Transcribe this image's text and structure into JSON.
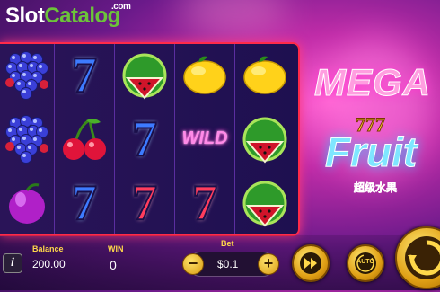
{
  "watermark": {
    "slot": "Slot",
    "catalog": "Catalog",
    "com": ".com"
  },
  "game_title": {
    "mega": "MEGA",
    "sevens": "777",
    "fruit": "Fruit",
    "subtitle": "超级水果"
  },
  "reels": [
    [
      "grapes",
      "grapes",
      "plum"
    ],
    [
      "seven-blue",
      "cherries",
      "seven-blue"
    ],
    [
      "watermelon",
      "seven-blue",
      "seven-red"
    ],
    [
      "lemon",
      "wild",
      "seven-red"
    ],
    [
      "lemon",
      "watermelon",
      "watermelon"
    ]
  ],
  "wild_label": "WILD",
  "seven_label": "7",
  "footer": {
    "info_label": "i",
    "balance_label": "Balance",
    "balance_value": "200.00",
    "win_label": "WIN",
    "win_value": "0",
    "bet_label": "Bet",
    "bet_value": "$0.1",
    "bet_minus": "−",
    "bet_plus": "+",
    "auto_label": "AUTO"
  },
  "colors": {
    "accent": "#ffd84a",
    "reel_frame": "#ff2a4a",
    "button_gold": "#e0a015"
  }
}
